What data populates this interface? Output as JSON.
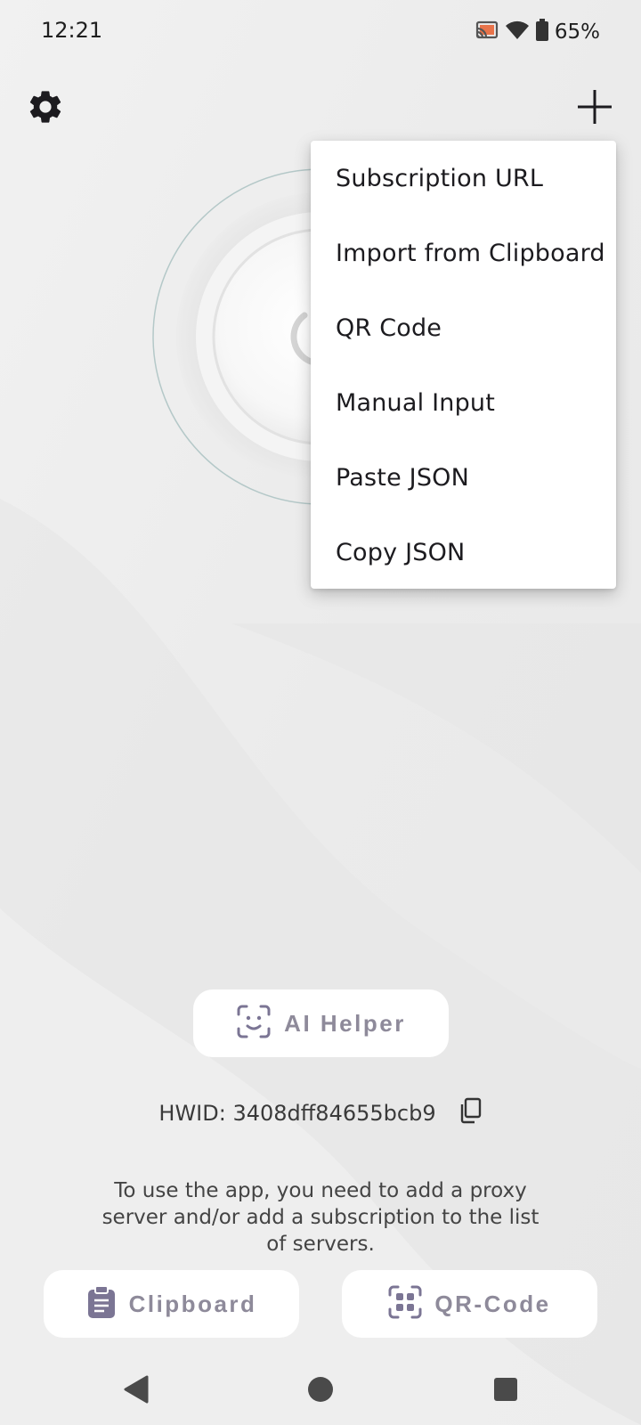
{
  "status_bar": {
    "time": "12:21",
    "battery": "65%",
    "icons": [
      "cast-icon",
      "wifi-icon",
      "battery-icon"
    ]
  },
  "toolbar": {
    "settings_icon": "gear-icon",
    "add_icon": "plus-icon"
  },
  "add_menu": {
    "items": [
      {
        "label": "Subscription URL"
      },
      {
        "label": "Import from Clipboard"
      },
      {
        "label": "QR Code"
      },
      {
        "label": "Manual Input"
      },
      {
        "label": "Paste JSON"
      },
      {
        "label": "Copy JSON"
      }
    ]
  },
  "ai_helper": {
    "label": "AI Helper",
    "icon": "face-scan-icon"
  },
  "hwid": {
    "text": "HWID: 3408dff84655bcb9",
    "icon": "copy-icon"
  },
  "info": {
    "text": "To use the app, you need to add a proxy server and/or add a subscription to the list of servers."
  },
  "actions": {
    "clipboard_label": "Clipboard",
    "clipboard_icon": "clipboard-icon",
    "qr_label": "QR-Code",
    "qr_icon": "qr-code-icon"
  },
  "nav": {
    "icons": [
      "back-icon",
      "home-icon",
      "recents-icon"
    ]
  },
  "colors": {
    "accent_muted": "#8e8a9a",
    "icon_purple": "#7b7594",
    "menu_bg": "#ffffff"
  }
}
